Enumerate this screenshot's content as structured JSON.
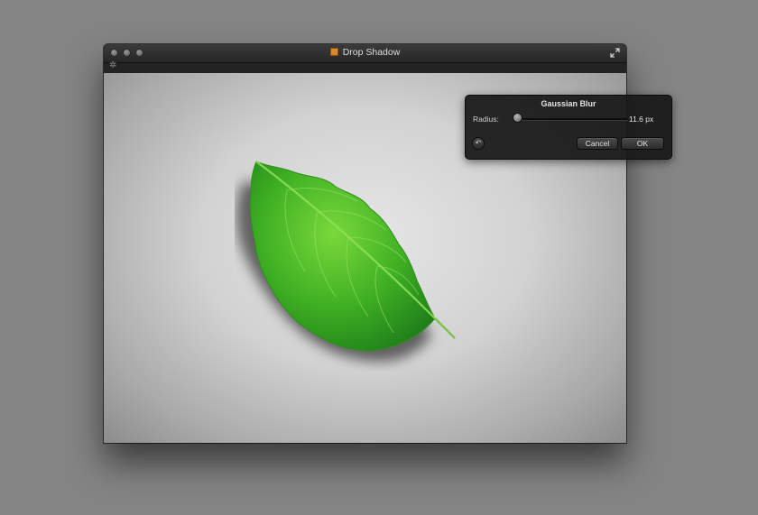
{
  "window": {
    "title": "Drop Shadow"
  },
  "blur_panel": {
    "title": "Gaussian Blur",
    "radius_label": "Radius:",
    "radius_value": "11.6 px",
    "cancel_label": "Cancel",
    "ok_label": "OK",
    "reset_icon": "↶"
  },
  "icons": {
    "toolbar_gear": "✲"
  },
  "colors": {
    "leaf_green": "#3fb023",
    "panel_bg": "#181818"
  }
}
